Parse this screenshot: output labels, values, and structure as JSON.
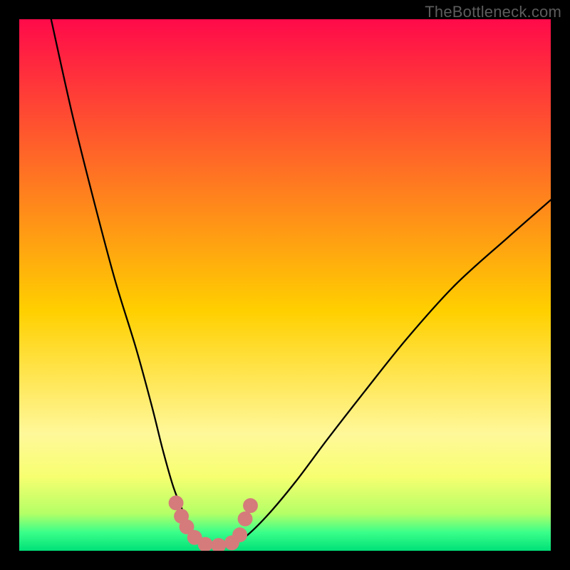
{
  "watermark": "TheBottleneck.com",
  "chart_data": {
    "type": "line",
    "title": "",
    "xlabel": "",
    "ylabel": "",
    "xlim": [
      0,
      100
    ],
    "ylim": [
      0,
      100
    ],
    "gradient_bands": [
      {
        "y": 0.0,
        "color": "#ff0a4a"
      },
      {
        "y": 0.55,
        "color": "#ffd000"
      },
      {
        "y": 0.78,
        "color": "#fff89a"
      },
      {
        "y": 0.86,
        "color": "#f7ff70"
      },
      {
        "y": 0.93,
        "color": "#b4ff66"
      },
      {
        "y": 0.965,
        "color": "#3bff8a"
      },
      {
        "y": 1.0,
        "color": "#00e078"
      }
    ],
    "series": [
      {
        "name": "left-arm",
        "type": "curve",
        "x": [
          6,
          10,
          14,
          18,
          22,
          25,
          27,
          29,
          31,
          32.5,
          34,
          35.5
        ],
        "y": [
          100,
          82,
          66,
          51,
          38,
          27,
          19,
          12,
          7,
          4,
          2,
          1
        ]
      },
      {
        "name": "right-arm",
        "type": "curve",
        "x": [
          40,
          43,
          47,
          52,
          58,
          65,
          73,
          82,
          92,
          100
        ],
        "y": [
          1,
          3,
          7,
          13,
          21,
          30,
          40,
          50,
          59,
          66
        ]
      },
      {
        "name": "markers",
        "type": "scatter",
        "points": [
          {
            "x": 29.5,
            "y": 9.0
          },
          {
            "x": 30.5,
            "y": 6.5
          },
          {
            "x": 31.5,
            "y": 4.5
          },
          {
            "x": 33.0,
            "y": 2.5
          },
          {
            "x": 35.0,
            "y": 1.2
          },
          {
            "x": 37.5,
            "y": 1.0
          },
          {
            "x": 40.0,
            "y": 1.5
          },
          {
            "x": 41.5,
            "y": 3.0
          },
          {
            "x": 42.5,
            "y": 6.0
          },
          {
            "x": 43.5,
            "y": 8.5
          }
        ],
        "marker_color": "#d57b7b",
        "marker_radius_pct": 1.4
      }
    ]
  }
}
